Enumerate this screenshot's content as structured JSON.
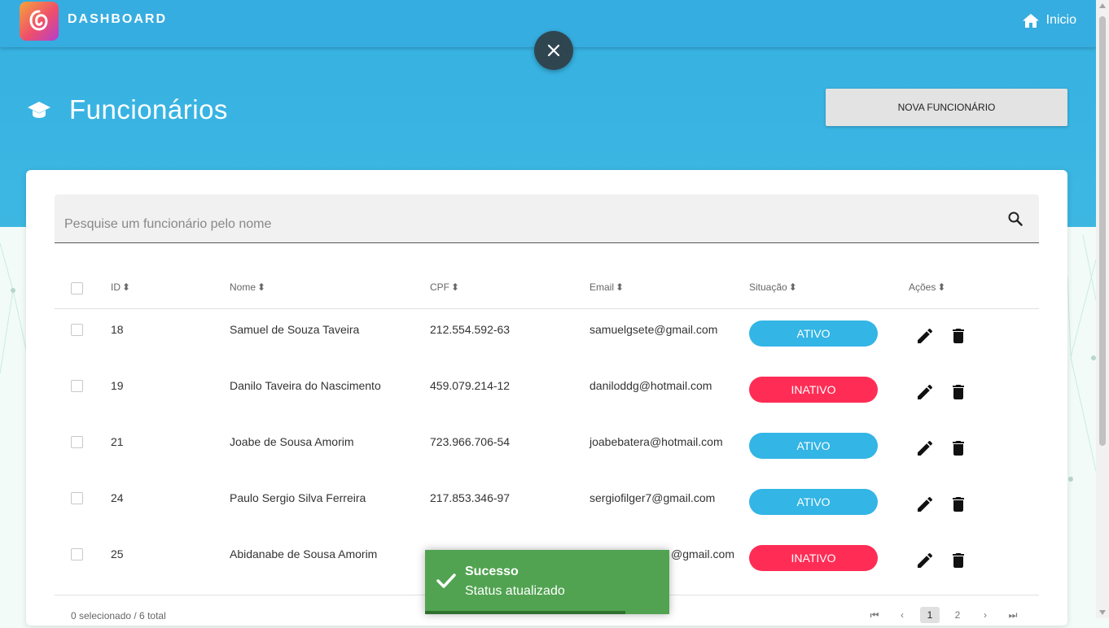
{
  "app": {
    "brand": "DASHBOARD",
    "home_label": "Inicio"
  },
  "page": {
    "title": "Funcionários",
    "new_button": "NOVA FUNCIONÁRIO"
  },
  "search": {
    "placeholder": "Pesquise um funcionário pelo nome",
    "value": ""
  },
  "table": {
    "columns": {
      "id": "ID",
      "name": "Nome",
      "cpf": "CPF",
      "email": "Email",
      "status": "Situação",
      "actions": "Ações"
    },
    "rows": [
      {
        "id": "18",
        "name": "Samuel de Souza Taveira",
        "cpf": "212.554.592-63",
        "email": "samuelgsete@gmail.com",
        "status": "ATIVO"
      },
      {
        "id": "19",
        "name": "Danilo Taveira do Nascimento",
        "cpf": "459.079.214-12",
        "email": "daniloddg@hotmail.com",
        "status": "INATIVO"
      },
      {
        "id": "21",
        "name": "Joabe de Sousa Amorim",
        "cpf": "723.966.706-54",
        "email": "joabebatera@hotmail.com",
        "status": "ATIVO"
      },
      {
        "id": "24",
        "name": "Paulo Sergio Silva Ferreira",
        "cpf": "217.853.346-97",
        "email": "sergiofilger7@gmail.com",
        "status": "ATIVO"
      },
      {
        "id": "25",
        "name": "Abidanabe de Sousa Amorim",
        "cpf": "",
        "email": "@gmail.com",
        "status": "INATIVO"
      }
    ],
    "footer": {
      "selection": "0 selecionado / 6 total",
      "pages": [
        "1",
        "2"
      ],
      "current_page": "1"
    }
  },
  "toast": {
    "title": "Sucesso",
    "message": "Status atualizado",
    "progress": 0.82
  },
  "colors": {
    "active": "#33b5e5",
    "inactive": "#ff2d55",
    "toast": "#51a351",
    "header": "#36ade0"
  },
  "icons": {
    "home": "home-icon",
    "close": "close-icon",
    "page": "graduation-cap-icon",
    "search": "search-icon",
    "edit": "pencil-icon",
    "delete": "trash-icon",
    "check": "check-icon"
  }
}
